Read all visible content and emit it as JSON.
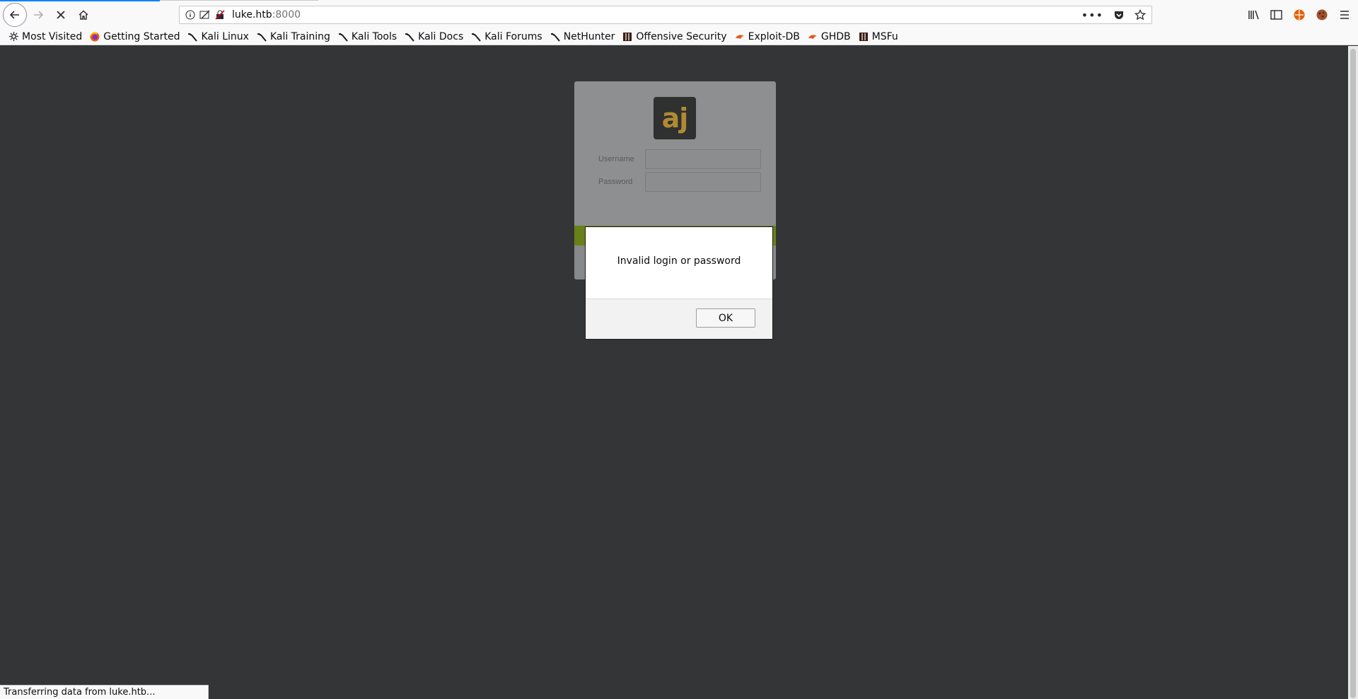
{
  "browser": {
    "url_host": "luke.htb",
    "url_port": ":8000",
    "status_text": "Transferring data from luke.htb..."
  },
  "bookmarks": [
    {
      "label": "Most Visited",
      "icon": "gear-icon"
    },
    {
      "label": "Getting Started",
      "icon": "firefox-icon"
    },
    {
      "label": "Kali Linux",
      "icon": "kali-dragon-icon"
    },
    {
      "label": "Kali Training",
      "icon": "kali-dragon-icon"
    },
    {
      "label": "Kali Tools",
      "icon": "kali-dragon-icon"
    },
    {
      "label": "Kali Docs",
      "icon": "kali-dragon-icon"
    },
    {
      "label": "Kali Forums",
      "icon": "kali-dragon-icon"
    },
    {
      "label": "NetHunter",
      "icon": "kali-dragon-icon"
    },
    {
      "label": "Offensive Security",
      "icon": "offsec-icon"
    },
    {
      "label": "Exploit-DB",
      "icon": "exploitdb-icon"
    },
    {
      "label": "GHDB",
      "icon": "exploitdb-icon"
    },
    {
      "label": "MSFu",
      "icon": "offsec-icon"
    }
  ],
  "login": {
    "logo_text": "aj",
    "username_label": "Username",
    "password_label": "Password"
  },
  "dialog": {
    "message": "Invalid login or password",
    "ok_label": "OK"
  }
}
